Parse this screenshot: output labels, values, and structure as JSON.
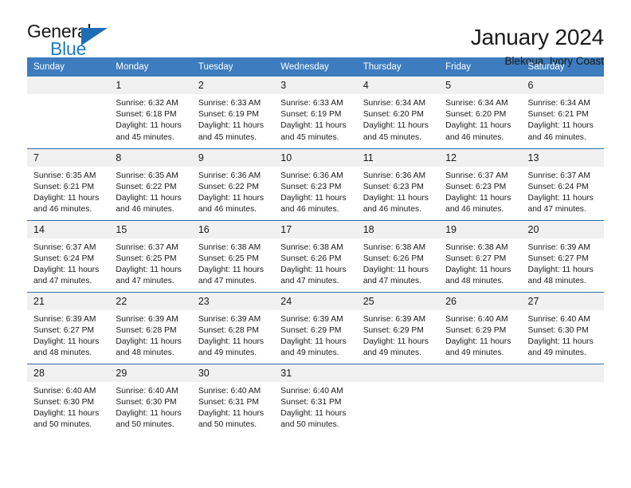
{
  "brand": {
    "name_top": "General",
    "name_bottom": "Blue",
    "triangle_color": "#1d6cb5",
    "blue_text_color": "#1d7ad1"
  },
  "header": {
    "title": "January 2024",
    "subtitle": "Blekoua, Ivory Coast"
  },
  "theme": {
    "header_bg": "#3d7cbf",
    "row_rule": "#2e6da4",
    "daynum_bg": "#f0f0f0",
    "text": "#1a1a1a"
  },
  "weekdays": [
    "Sunday",
    "Monday",
    "Tuesday",
    "Wednesday",
    "Thursday",
    "Friday",
    "Saturday"
  ],
  "weeks": [
    [
      {
        "day": "",
        "detail": ""
      },
      {
        "day": "1",
        "detail": "Sunrise: 6:32 AM\nSunset: 6:18 PM\nDaylight: 11 hours\nand 45 minutes."
      },
      {
        "day": "2",
        "detail": "Sunrise: 6:33 AM\nSunset: 6:19 PM\nDaylight: 11 hours\nand 45 minutes."
      },
      {
        "day": "3",
        "detail": "Sunrise: 6:33 AM\nSunset: 6:19 PM\nDaylight: 11 hours\nand 45 minutes."
      },
      {
        "day": "4",
        "detail": "Sunrise: 6:34 AM\nSunset: 6:20 PM\nDaylight: 11 hours\nand 45 minutes."
      },
      {
        "day": "5",
        "detail": "Sunrise: 6:34 AM\nSunset: 6:20 PM\nDaylight: 11 hours\nand 46 minutes."
      },
      {
        "day": "6",
        "detail": "Sunrise: 6:34 AM\nSunset: 6:21 PM\nDaylight: 11 hours\nand 46 minutes."
      }
    ],
    [
      {
        "day": "7",
        "detail": "Sunrise: 6:35 AM\nSunset: 6:21 PM\nDaylight: 11 hours\nand 46 minutes."
      },
      {
        "day": "8",
        "detail": "Sunrise: 6:35 AM\nSunset: 6:22 PM\nDaylight: 11 hours\nand 46 minutes."
      },
      {
        "day": "9",
        "detail": "Sunrise: 6:36 AM\nSunset: 6:22 PM\nDaylight: 11 hours\nand 46 minutes."
      },
      {
        "day": "10",
        "detail": "Sunrise: 6:36 AM\nSunset: 6:23 PM\nDaylight: 11 hours\nand 46 minutes."
      },
      {
        "day": "11",
        "detail": "Sunrise: 6:36 AM\nSunset: 6:23 PM\nDaylight: 11 hours\nand 46 minutes."
      },
      {
        "day": "12",
        "detail": "Sunrise: 6:37 AM\nSunset: 6:23 PM\nDaylight: 11 hours\nand 46 minutes."
      },
      {
        "day": "13",
        "detail": "Sunrise: 6:37 AM\nSunset: 6:24 PM\nDaylight: 11 hours\nand 47 minutes."
      }
    ],
    [
      {
        "day": "14",
        "detail": "Sunrise: 6:37 AM\nSunset: 6:24 PM\nDaylight: 11 hours\nand 47 minutes."
      },
      {
        "day": "15",
        "detail": "Sunrise: 6:37 AM\nSunset: 6:25 PM\nDaylight: 11 hours\nand 47 minutes."
      },
      {
        "day": "16",
        "detail": "Sunrise: 6:38 AM\nSunset: 6:25 PM\nDaylight: 11 hours\nand 47 minutes."
      },
      {
        "day": "17",
        "detail": "Sunrise: 6:38 AM\nSunset: 6:26 PM\nDaylight: 11 hours\nand 47 minutes."
      },
      {
        "day": "18",
        "detail": "Sunrise: 6:38 AM\nSunset: 6:26 PM\nDaylight: 11 hours\nand 47 minutes."
      },
      {
        "day": "19",
        "detail": "Sunrise: 6:38 AM\nSunset: 6:27 PM\nDaylight: 11 hours\nand 48 minutes."
      },
      {
        "day": "20",
        "detail": "Sunrise: 6:39 AM\nSunset: 6:27 PM\nDaylight: 11 hours\nand 48 minutes."
      }
    ],
    [
      {
        "day": "21",
        "detail": "Sunrise: 6:39 AM\nSunset: 6:27 PM\nDaylight: 11 hours\nand 48 minutes."
      },
      {
        "day": "22",
        "detail": "Sunrise: 6:39 AM\nSunset: 6:28 PM\nDaylight: 11 hours\nand 48 minutes."
      },
      {
        "day": "23",
        "detail": "Sunrise: 6:39 AM\nSunset: 6:28 PM\nDaylight: 11 hours\nand 49 minutes."
      },
      {
        "day": "24",
        "detail": "Sunrise: 6:39 AM\nSunset: 6:29 PM\nDaylight: 11 hours\nand 49 minutes."
      },
      {
        "day": "25",
        "detail": "Sunrise: 6:39 AM\nSunset: 6:29 PM\nDaylight: 11 hours\nand 49 minutes."
      },
      {
        "day": "26",
        "detail": "Sunrise: 6:40 AM\nSunset: 6:29 PM\nDaylight: 11 hours\nand 49 minutes."
      },
      {
        "day": "27",
        "detail": "Sunrise: 6:40 AM\nSunset: 6:30 PM\nDaylight: 11 hours\nand 49 minutes."
      }
    ],
    [
      {
        "day": "28",
        "detail": "Sunrise: 6:40 AM\nSunset: 6:30 PM\nDaylight: 11 hours\nand 50 minutes."
      },
      {
        "day": "29",
        "detail": "Sunrise: 6:40 AM\nSunset: 6:30 PM\nDaylight: 11 hours\nand 50 minutes."
      },
      {
        "day": "30",
        "detail": "Sunrise: 6:40 AM\nSunset: 6:31 PM\nDaylight: 11 hours\nand 50 minutes."
      },
      {
        "day": "31",
        "detail": "Sunrise: 6:40 AM\nSunset: 6:31 PM\nDaylight: 11 hours\nand 50 minutes."
      },
      {
        "day": "",
        "detail": ""
      },
      {
        "day": "",
        "detail": ""
      },
      {
        "day": "",
        "detail": ""
      }
    ]
  ]
}
